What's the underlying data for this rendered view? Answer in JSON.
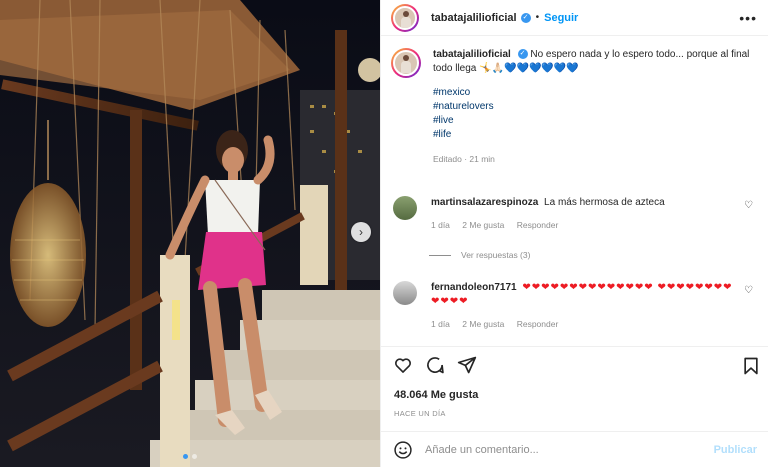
{
  "post": {
    "username": "tabatajalilioficial",
    "follow_label": "Seguir",
    "separator": "•",
    "more_label": "•••"
  },
  "caption": {
    "username": "tabatajalilioficial",
    "text": "No espero nada y lo espero todo... porque al final todo llega 🤸🙏🏻💙💙💙💙💙💙",
    "hashtags": [
      "#mexico",
      "#naturelovers",
      "#live",
      "#life"
    ],
    "edited": "Editado · 21 min"
  },
  "comments": [
    {
      "username": "martinsalazarespinoza",
      "text": "La más hermosa de azteca",
      "time": "1 día",
      "likes": "2 Me gusta",
      "reply": "Responder"
    },
    {
      "username": "fernandoleon7171",
      "text": "❤❤❤❤❤❤❤❤❤❤❤❤❤❤ ❤❤❤❤❤❤❤❤❤❤❤❤",
      "time": "1 día",
      "likes": "2 Me gusta",
      "reply": "Responder"
    }
  ],
  "replies_label": "Ver respuestas (3)",
  "stats": {
    "likes": "48.064 Me gusta",
    "ago": "HACE UN DÍA"
  },
  "add_comment": {
    "placeholder": "Añade un comentario...",
    "publish": "Publicar"
  },
  "carousel": {
    "current": 1,
    "total": 2
  },
  "icons": {
    "like": "heart-outline-icon",
    "comment": "comment-icon",
    "share": "paper-plane-icon",
    "save": "bookmark-icon",
    "emoji": "smiley-icon",
    "next": "chevron-right-icon"
  },
  "colors": {
    "accent": "#0095f6",
    "verified": "#3897f0",
    "hashtag": "#00376b",
    "muted": "#8e8e8e"
  }
}
